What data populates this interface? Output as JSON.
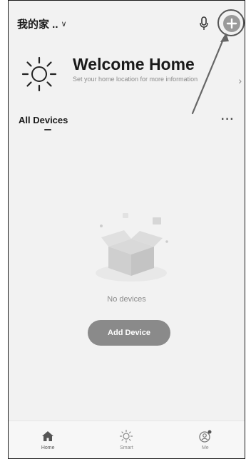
{
  "header": {
    "home_name": "我的家 ..",
    "chevron_icon": "chevron-down-icon",
    "mic_icon": "microphone-icon",
    "add_icon": "plus-circle-icon"
  },
  "welcome": {
    "icon": "sun-icon",
    "title": "Welcome Home",
    "subtitle": "Set your home location for more information",
    "chevron": "›"
  },
  "devices": {
    "section_title": "All Devices",
    "more_icon": "···",
    "empty_text": "No devices",
    "add_button_label": "Add Device"
  },
  "tabbar": {
    "tabs": [
      {
        "label": "Home",
        "icon": "home-icon",
        "active": true
      },
      {
        "label": "Smart",
        "icon": "sun-outline-icon",
        "active": false
      },
      {
        "label": "Me",
        "icon": "profile-icon",
        "active": false
      }
    ]
  },
  "colors": {
    "background": "#f2f2f2",
    "button": "#8a8a8a",
    "text": "#1a1a1a",
    "muted": "#8a8a8a"
  }
}
